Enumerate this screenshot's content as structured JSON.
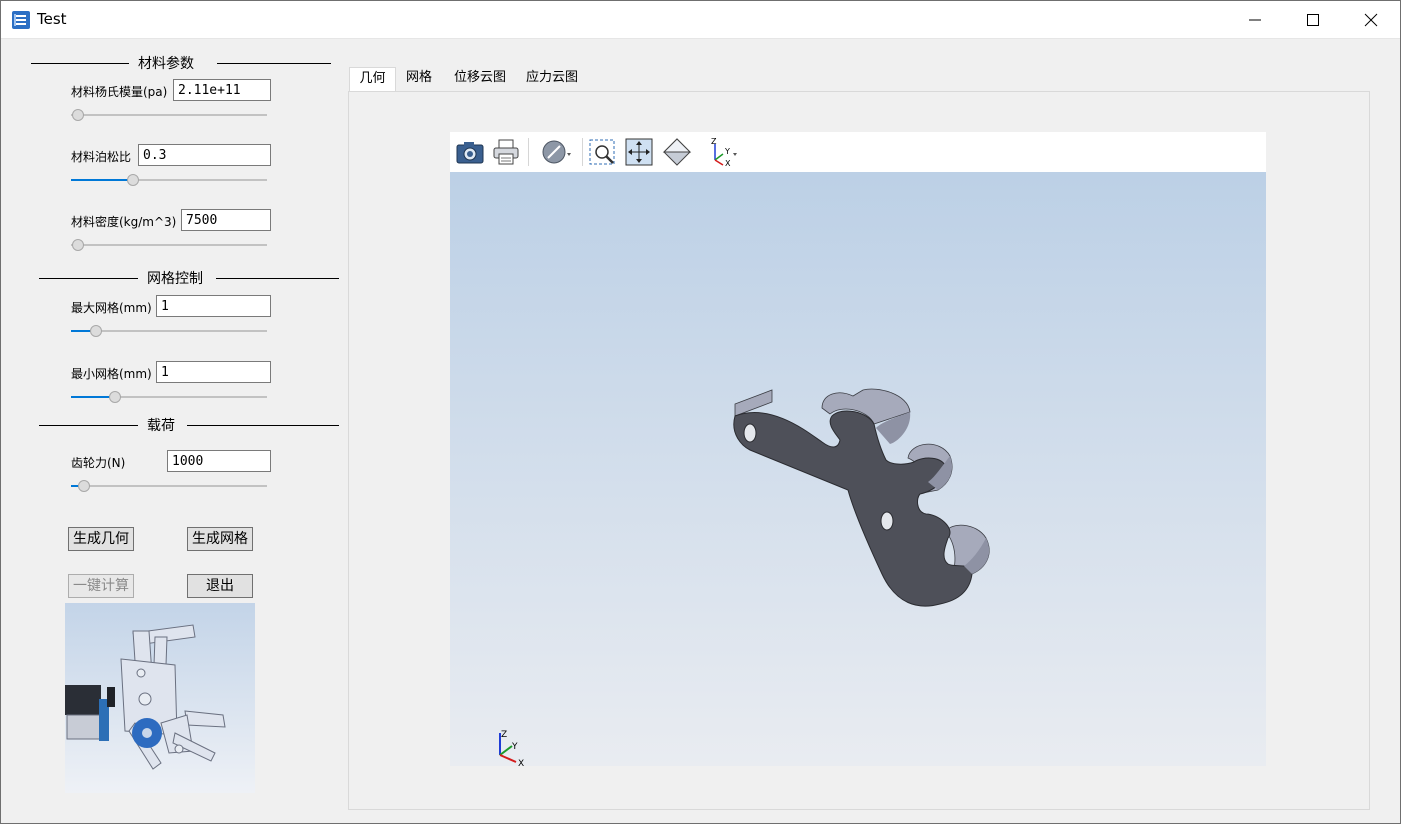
{
  "window": {
    "title": "Test",
    "minimize": "minimize",
    "maximize": "maximize",
    "close": "close"
  },
  "material": {
    "section_title": "材料参数",
    "youngs_label": "材料杨氏模量(pa)",
    "youngs_value": "2.11e+11",
    "youngs_slider": 0.0,
    "poisson_label": "材料泊松比",
    "poisson_value": "0.3",
    "poisson_slider": 0.3,
    "density_label": "材料密度(kg/m^3)",
    "density_value": "7500",
    "density_slider": 0.0
  },
  "mesh": {
    "section_title": "网格控制",
    "max_label": "最大网格(mm)",
    "max_value": "1",
    "max_slider": 0.1,
    "min_label": "最小网格(mm)",
    "min_value": "1",
    "min_slider": 0.2
  },
  "load": {
    "section_title": "载荷",
    "gear_force_label": "齿轮力(N)",
    "gear_force_value": "1000",
    "gear_force_slider": 0.03
  },
  "buttons": {
    "gen_geometry": "生成几何",
    "gen_mesh": "生成网格",
    "compute": "一键计算",
    "exit": "退出"
  },
  "tabs": [
    {
      "label": "几何",
      "active": true
    },
    {
      "label": "网格",
      "active": false
    },
    {
      "label": "位移云图",
      "active": false
    },
    {
      "label": "应力云图",
      "active": false
    }
  ],
  "viewer": {
    "toolbar_icons": [
      "camera-icon",
      "print-icon",
      "display-mode-icon",
      "zoom-window-icon",
      "fit-all-icon",
      "view-cube-icon",
      "axis-view-icon"
    ],
    "axis_labels": {
      "z": "Z",
      "y": "Y",
      "x": "X"
    }
  },
  "colors": {
    "accent": "#0078d7",
    "part_side": "#4e5059",
    "part_top": "#a9acbc",
    "viewer_bg_top": "#bcd0e6",
    "viewer_bg_bottom": "#e9ecf1"
  }
}
